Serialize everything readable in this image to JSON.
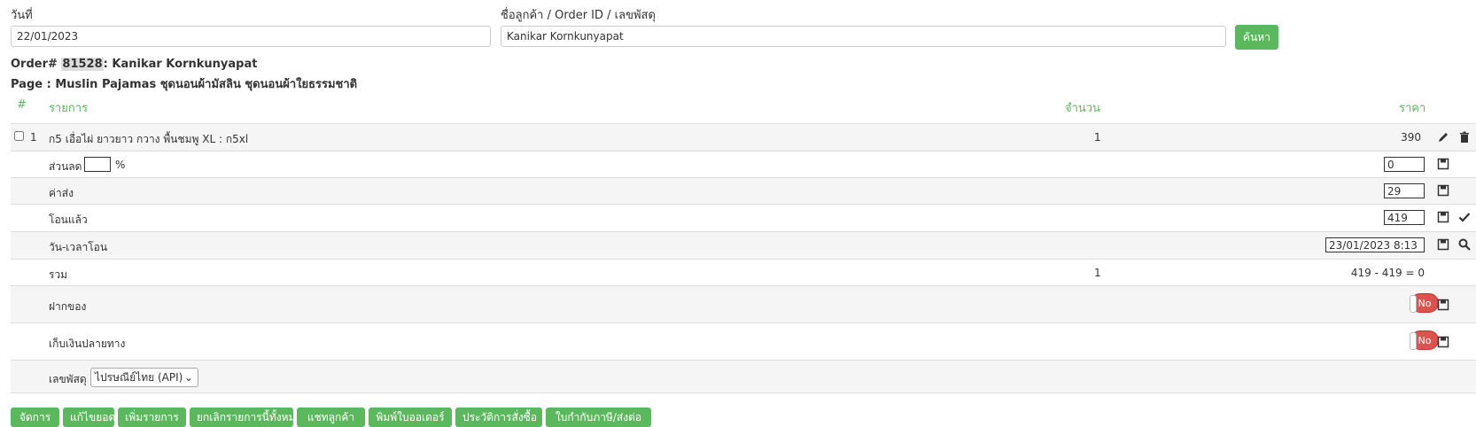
{
  "filters": {
    "date_label": "วันที่",
    "date_value": "22/01/2023",
    "search_label": "ชื่อลูกค้า / Order ID / เลขพัสดุ",
    "search_value": "Kanikar Kornkunyapat",
    "search_button": "ค้นหา"
  },
  "order": {
    "prefix": "Order#",
    "id": "81528",
    "customer": ": Kanikar Kornkunyapat",
    "page_line": "Page : Muslin Pajamas ชุดนอนผ้ามัสลิน ชุดนอนผ้าใยธรรมชาติ"
  },
  "table": {
    "headers": {
      "index": "#",
      "item": "รายการ",
      "qty": "จำนวน",
      "price": "ราคา"
    },
    "items": [
      {
        "index": "1",
        "name": "ก5 เอื่อไผ่ ยาวยาว กวาง พื้นชมพู XL : ก5xl",
        "qty": "1",
        "price": "390"
      }
    ],
    "discount": {
      "label": "ส่วนลด",
      "percent_sign": "%",
      "percent_value": "",
      "value": "0"
    },
    "shipping": {
      "label": "ค่าส่ง",
      "value": "29"
    },
    "transferred": {
      "label": "โอนแล้ว",
      "value": "419"
    },
    "transfer_time": {
      "label": "วัน-เวลาโอน",
      "value": "23/01/2023 8:13"
    },
    "total": {
      "label": "รวม",
      "qty": "1",
      "value": "419 - 419 = 0"
    },
    "deposit": {
      "label": "ฝากของ",
      "toggle": "No"
    },
    "cod": {
      "label": "เก็บเงินปลายทาง",
      "toggle": "No"
    },
    "tracking": {
      "label": "เลขพัสดุ",
      "selected": "ไปรษณีย์ไทย (API)"
    }
  },
  "actions": [
    "จัดการ",
    "แก้ไขยอด",
    "เพิ่มรายการ",
    "ยกเลิกรายการนี้ทั้งหมด",
    "แชทลูกค้า",
    "พิมพ์ใบออเดอร์",
    "ประวัติการสั่งซื้อ",
    "ใบกำกับภาษี/ส่งต่อ"
  ],
  "colors": {
    "accent": "#5cb85c",
    "danger": "#d9534f",
    "row_alt": "#f5f5f5"
  }
}
